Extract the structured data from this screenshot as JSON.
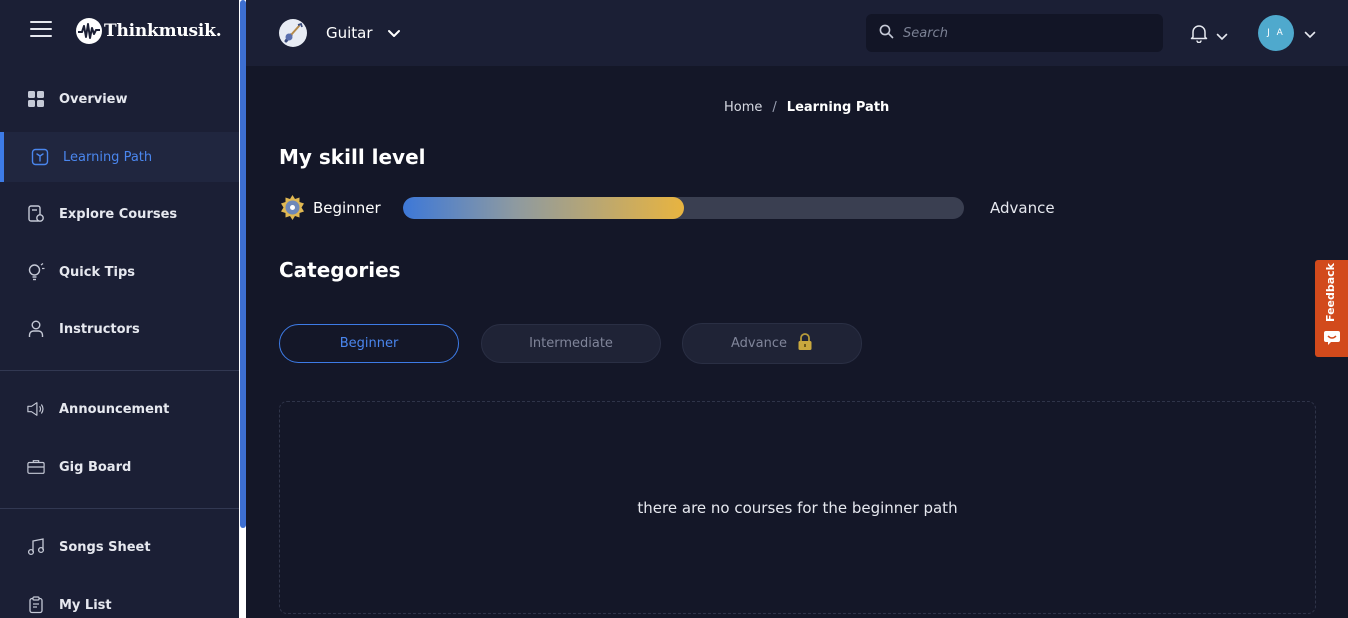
{
  "app": {
    "brand": "Thinkmusik."
  },
  "sidebar": {
    "items": [
      {
        "label": "Overview"
      },
      {
        "label": "Learning Path"
      },
      {
        "label": "Explore Courses"
      },
      {
        "label": "Quick Tips"
      },
      {
        "label": "Instructors"
      },
      {
        "label": "Announcement"
      },
      {
        "label": "Gig Board"
      },
      {
        "label": "Songs Sheet"
      },
      {
        "label": "My List"
      }
    ]
  },
  "header": {
    "instrument": "Guitar",
    "search_placeholder": "Search",
    "user_initials": "J A"
  },
  "breadcrumb": {
    "home": "Home",
    "separator": "/",
    "current": "Learning Path"
  },
  "skill": {
    "title": "My skill level",
    "start_label": "Beginner",
    "end_label": "Advance",
    "progress_fraction": 0.5
  },
  "categories": {
    "title": "Categories",
    "tabs": [
      {
        "label": "Beginner",
        "state": "active"
      },
      {
        "label": "Intermediate",
        "state": "inactive"
      },
      {
        "label": "Advance",
        "state": "locked"
      }
    ]
  },
  "empty_message": "there are no courses for the beginner path",
  "feedback": {
    "label": "Feedback"
  },
  "colors": {
    "accent": "#3d7be6",
    "background": "#141728",
    "sidebar": "#1b1f35",
    "feedback": "#d24a1c",
    "avatar": "#4fa9cd"
  }
}
